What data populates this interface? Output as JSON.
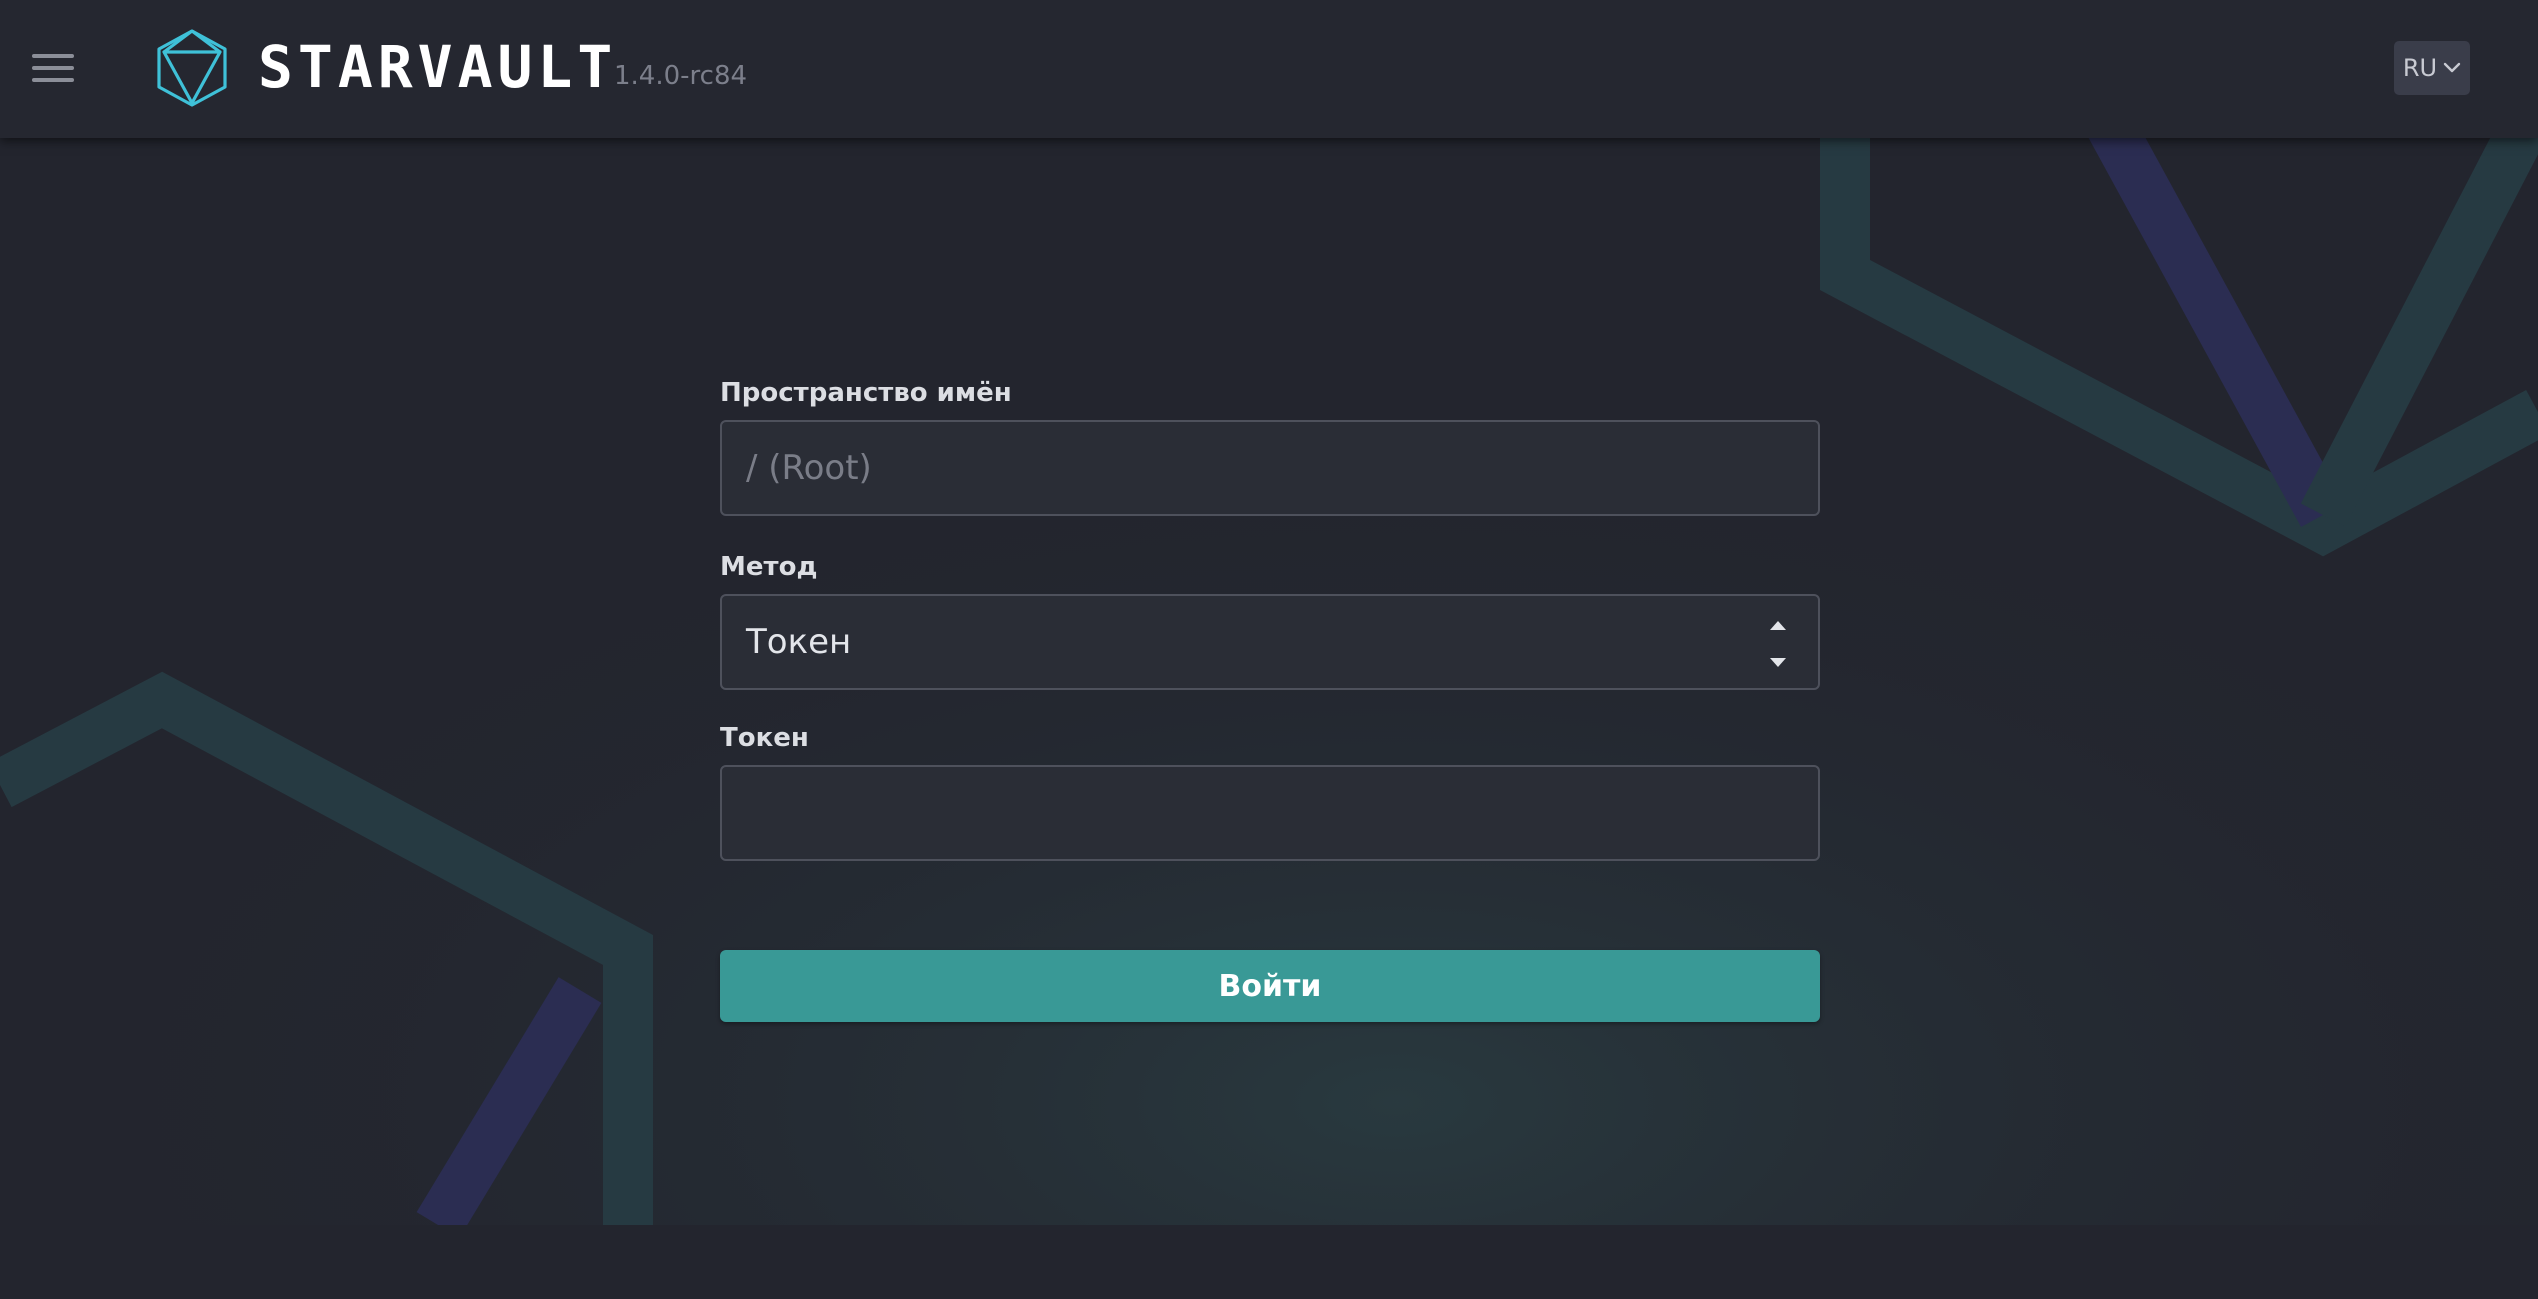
{
  "header": {
    "brand": "STARVAULT",
    "version": "1.4.0-rc84",
    "language": "RU",
    "icons": {
      "menu": "hamburger-menu-icon",
      "logo": "geometric-polyhedron-logo-icon",
      "language_chevron": "chevron-down-icon"
    }
  },
  "form": {
    "namespace": {
      "label": "Пространство имён",
      "value": "",
      "placeholder": "/ (Root)"
    },
    "method": {
      "label": "Метод",
      "selected": "Токен"
    },
    "token": {
      "label": "Токен",
      "value": "",
      "placeholder": ""
    },
    "submit_label": "Войти"
  },
  "colors": {
    "background": "#23252e",
    "header": "#252730",
    "accent": "#399996",
    "logo_stroke": "#3fc1d8",
    "field_border": "#4e515c"
  }
}
